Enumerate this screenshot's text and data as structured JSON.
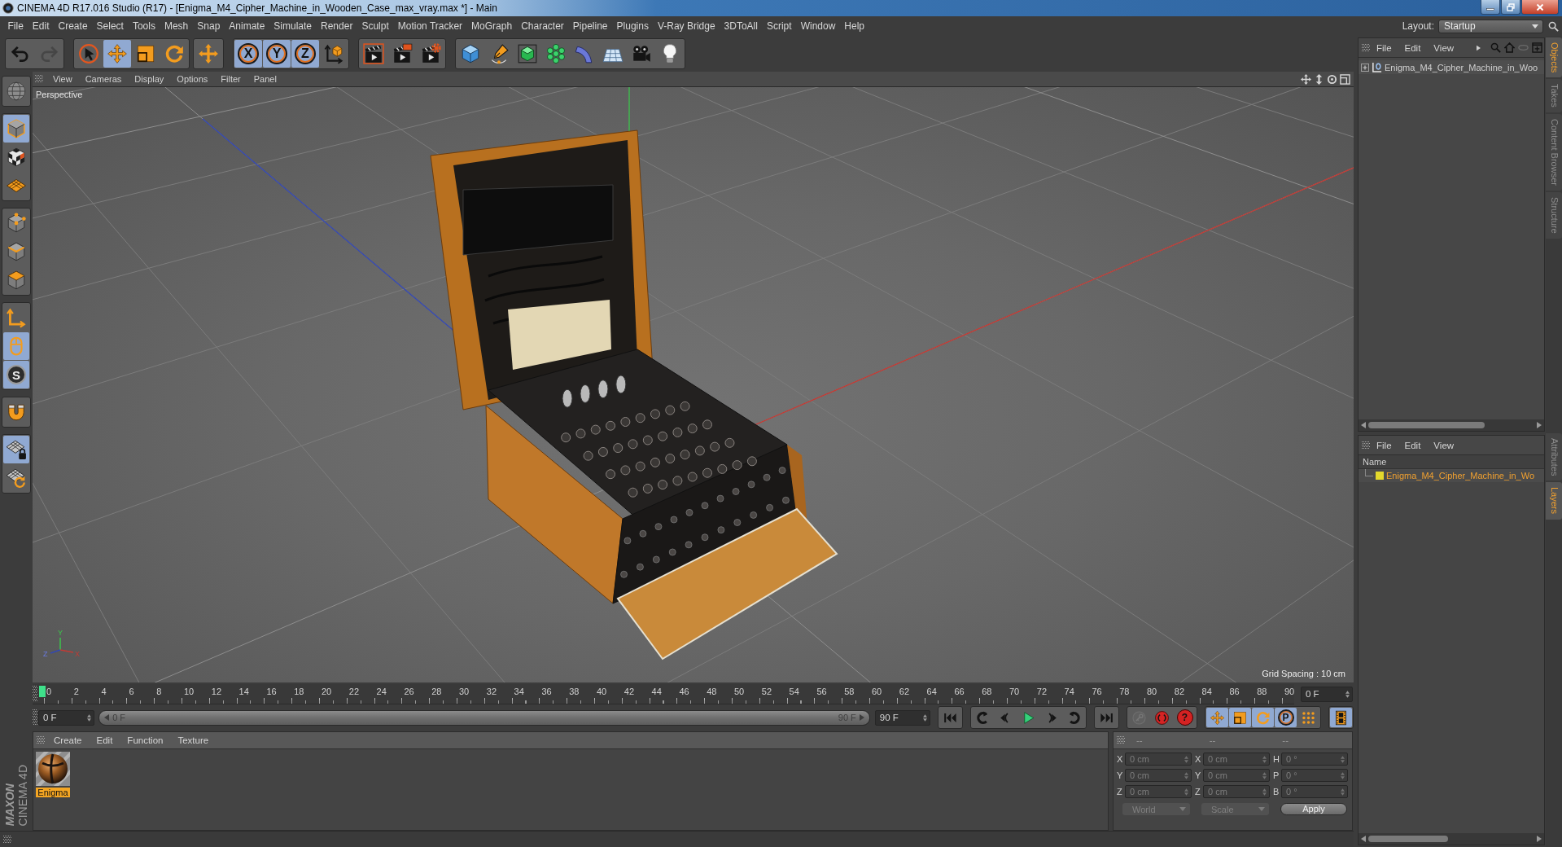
{
  "window": {
    "title": "CINEMA 4D R17.016 Studio (R17) - [Enigma_M4_Cipher_Machine_in_Wooden_Case_max_vray.max *] - Main"
  },
  "menu_bar": {
    "items": [
      "File",
      "Edit",
      "Create",
      "Select",
      "Tools",
      "Mesh",
      "Snap",
      "Animate",
      "Simulate",
      "Render",
      "Sculpt",
      "Motion Tracker",
      "MoGraph",
      "Character",
      "Pipeline",
      "Plugins",
      "V-Ray Bridge",
      "3DToAll",
      "Script",
      "Window",
      "Help"
    ],
    "layout": {
      "label": "Layout:",
      "value": "Startup"
    }
  },
  "toolbar": {
    "groups": [
      [
        {
          "kind": "undo",
          "selected": false,
          "disabled": false
        },
        {
          "kind": "redo",
          "selected": false,
          "disabled": true
        }
      ],
      [
        {
          "kind": "select",
          "selected": false,
          "disabled": false
        },
        {
          "kind": "move",
          "selected": true,
          "disabled": false
        },
        {
          "kind": "scale",
          "selected": false,
          "disabled": false
        },
        {
          "kind": "rotate",
          "selected": false,
          "disabled": false
        }
      ],
      [
        {
          "kind": "crosshair",
          "selected": false,
          "disabled": false
        }
      ],
      [
        {
          "kind": "axislock",
          "label": "X",
          "selected": true,
          "disabled": false
        },
        {
          "kind": "axislock",
          "label": "Y",
          "selected": true,
          "disabled": false
        },
        {
          "kind": "axislock",
          "label": "Z",
          "selected": true,
          "disabled": false
        },
        {
          "kind": "coords",
          "selected": false,
          "disabled": false
        }
      ],
      [
        {
          "kind": "renderview",
          "selected": false,
          "disabled": false
        },
        {
          "kind": "renderpicture",
          "selected": false,
          "disabled": false
        },
        {
          "kind": "rendersettings",
          "selected": false,
          "disabled": false
        }
      ],
      [
        {
          "kind": "cube",
          "selected": false,
          "disabled": false
        },
        {
          "kind": "pen",
          "selected": false,
          "disabled": false
        },
        {
          "kind": "subdivide",
          "selected": false,
          "disabled": false
        },
        {
          "kind": "cloner",
          "selected": false,
          "disabled": false
        },
        {
          "kind": "deformer",
          "selected": false,
          "disabled": false
        },
        {
          "kind": "floor",
          "selected": false,
          "disabled": false
        },
        {
          "kind": "camera",
          "selected": false,
          "disabled": false
        },
        {
          "kind": "light",
          "selected": false,
          "disabled": false
        }
      ]
    ]
  },
  "left_toolbar": {
    "groups": [
      [
        {
          "kind": "globe",
          "selected": false
        }
      ],
      [
        {
          "kind": "model",
          "selected": true
        },
        {
          "kind": "texture",
          "selected": false
        },
        {
          "kind": "workplane",
          "selected": false
        }
      ],
      [
        {
          "kind": "points",
          "selected": false
        },
        {
          "kind": "edges",
          "selected": false
        },
        {
          "kind": "polygons",
          "selected": false
        }
      ],
      [
        {
          "kind": "axis",
          "selected": false
        },
        {
          "kind": "tweak",
          "selected": true
        },
        {
          "kind": "solo",
          "label": "S",
          "selected": true
        }
      ],
      [
        {
          "kind": "magnet",
          "selected": false
        }
      ],
      [
        {
          "kind": "gridlock",
          "selected": true
        },
        {
          "kind": "gridrotate",
          "selected": false
        }
      ]
    ]
  },
  "viewport": {
    "menu": [
      "View",
      "Cameras",
      "Display",
      "Options",
      "Filter",
      "Panel"
    ],
    "camera": "Perspective",
    "grid_spacing": "Grid Spacing : 10 cm",
    "gizmo": {
      "x": "X",
      "y": "Y",
      "z": "Z"
    }
  },
  "timeline": {
    "ticks": [
      "0",
      "2",
      "4",
      "6",
      "8",
      "10",
      "12",
      "14",
      "16",
      "18",
      "20",
      "22",
      "24",
      "26",
      "28",
      "30",
      "32",
      "34",
      "36",
      "38",
      "40",
      "42",
      "44",
      "46",
      "48",
      "50",
      "52",
      "54",
      "56",
      "58",
      "60",
      "62",
      "64",
      "66",
      "68",
      "70",
      "72",
      "74",
      "76",
      "78",
      "80",
      "82",
      "84",
      "86",
      "88",
      "90"
    ],
    "level": 0,
    "current_frame": "0 F"
  },
  "transport": {
    "start_field": "0 F",
    "range": {
      "start": "0 F",
      "end": "90 F",
      "level": 1
    },
    "end_field": "90 F",
    "groups": [
      [
        {
          "kind": "first",
          "selected": false,
          "disabled": false
        }
      ],
      [
        {
          "kind": "prevkey",
          "selected": false,
          "disabled": false
        },
        {
          "kind": "prevframe",
          "selected": false,
          "disabled": false
        },
        {
          "kind": "play",
          "selected": false,
          "disabled": false
        },
        {
          "kind": "nextframe",
          "selected": false,
          "disabled": false
        },
        {
          "kind": "nextkey",
          "selected": false,
          "disabled": false
        }
      ],
      [
        {
          "kind": "last",
          "selected": false,
          "disabled": false
        }
      ],
      [
        {
          "kind": "recordkey",
          "selected": false,
          "disabled": true
        },
        {
          "kind": "autokey",
          "selected": false,
          "disabled": false
        },
        {
          "kind": "keyhelp",
          "label": "?",
          "selected": false,
          "disabled": false
        }
      ],
      [
        {
          "kind": "poskey",
          "selected": true,
          "disabled": false
        },
        {
          "kind": "scalekey",
          "selected": true,
          "disabled": false
        },
        {
          "kind": "rotkey",
          "selected": true,
          "disabled": false
        },
        {
          "kind": "parameter",
          "label": "P",
          "selected": true,
          "disabled": false
        },
        {
          "kind": "pointlevel",
          "selected": false,
          "disabled": false
        }
      ],
      [
        {
          "kind": "timeline",
          "selected": true,
          "disabled": false
        }
      ]
    ]
  },
  "materials": {
    "menu": [
      "Create",
      "Edit",
      "Function",
      "Texture"
    ],
    "items": [
      {
        "name": "Enigma",
        "selected": true
      }
    ]
  },
  "coordinates": {
    "headers": [
      "--",
      "--",
      "--"
    ],
    "rows": [
      [
        {
          "axis": "X",
          "value": "0 cm"
        },
        {
          "axis": "X",
          "value": "0 cm"
        },
        {
          "axis": "H",
          "value": "0 °"
        }
      ],
      [
        {
          "axis": "Y",
          "value": "0 cm"
        },
        {
          "axis": "Y",
          "value": "0 cm"
        },
        {
          "axis": "P",
          "value": "0 °"
        }
      ],
      [
        {
          "axis": "Z",
          "value": "0 cm"
        },
        {
          "axis": "Z",
          "value": "0 cm"
        },
        {
          "axis": "B",
          "value": "0 °"
        }
      ]
    ],
    "dropdowns": [
      "World",
      "Scale"
    ],
    "apply": "Apply"
  },
  "objects": {
    "menu": [
      "File",
      "Edit",
      "View"
    ],
    "items": [
      {
        "name": "Enigma_M4_Cipher_Machine_in_Woo",
        "expanded": false
      }
    ]
  },
  "layers": {
    "menu": [
      "File",
      "Edit",
      "View"
    ],
    "column": "Name",
    "items": [
      {
        "name": "Enigma_M4_Cipher_Machine_in_Wo",
        "color": "#e3d82c",
        "selected": true
      }
    ]
  },
  "side_tabs": {
    "upper": [
      {
        "label": "Objects",
        "selected": true
      },
      {
        "label": "Takes",
        "selected": false
      },
      {
        "label": "Content Browser",
        "selected": false
      },
      {
        "label": "Structure",
        "selected": false
      }
    ],
    "lower": [
      {
        "label": "Attributes",
        "selected": false
      },
      {
        "label": "Layers",
        "selected": true
      }
    ]
  },
  "logo": {
    "brand": "MAXON",
    "product": "CINEMA 4D"
  }
}
